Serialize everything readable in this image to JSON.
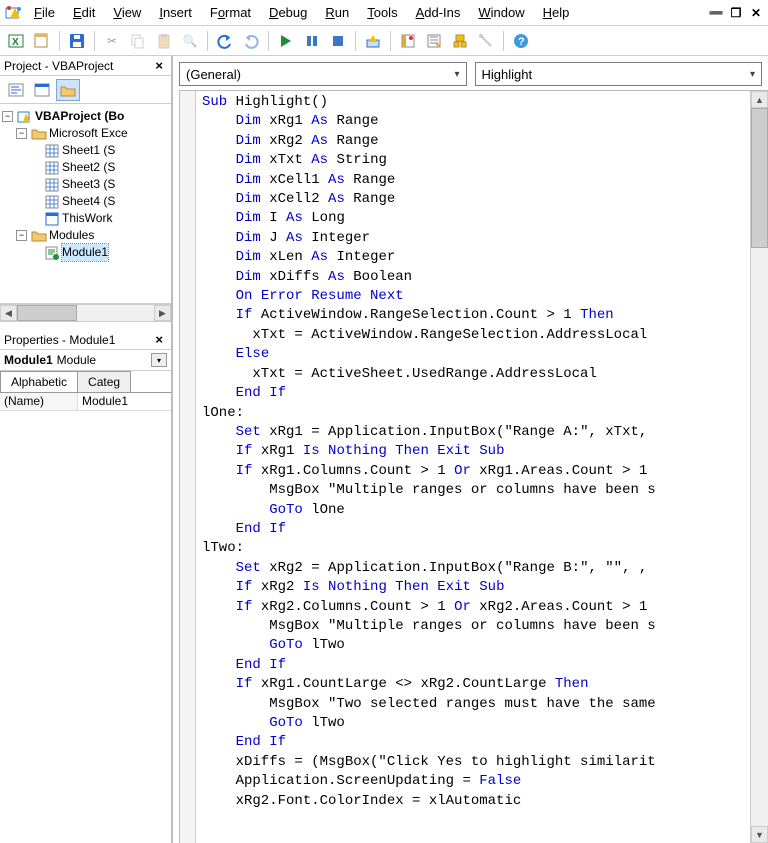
{
  "app": {
    "title": "Microsoft Visual Basic for Applications"
  },
  "menu": {
    "file": "File",
    "edit": "Edit",
    "view": "View",
    "insert": "Insert",
    "format": "Format",
    "debug": "Debug",
    "run": "Run",
    "tools": "Tools",
    "addins": "Add-Ins",
    "window": "Window",
    "help": "Help"
  },
  "project_panel": {
    "title": "Project - VBAProject",
    "root": "VBAProject (Bo",
    "excel_folder": "Microsoft Exce",
    "sheets": [
      "Sheet1 (S",
      "Sheet2 (S",
      "Sheet3 (S",
      "Sheet4 (S"
    ],
    "thisworkbook": "ThisWork",
    "modules_folder": "Modules",
    "module1": "Module1"
  },
  "properties_panel": {
    "title": "Properties - Module1",
    "selected_name": "Module1",
    "selected_type": "Module",
    "tabs": [
      "Alphabetic",
      "Categ"
    ],
    "prop_name_key": "(Name)",
    "prop_name_val": "Module1"
  },
  "dropdowns": {
    "object": "(General)",
    "proc": "Highlight"
  },
  "code_tokens": [
    [
      [
        "kw",
        "Sub"
      ],
      [
        "",
        " Highlight()"
      ]
    ],
    [
      [
        "",
        "    "
      ],
      [
        "kw",
        "Dim"
      ],
      [
        "",
        " xRg1 "
      ],
      [
        "kw",
        "As"
      ],
      [
        "",
        " Range"
      ]
    ],
    [
      [
        "",
        "    "
      ],
      [
        "kw",
        "Dim"
      ],
      [
        "",
        " xRg2 "
      ],
      [
        "kw",
        "As"
      ],
      [
        "",
        " Range"
      ]
    ],
    [
      [
        "",
        "    "
      ],
      [
        "kw",
        "Dim"
      ],
      [
        "",
        " xTxt "
      ],
      [
        "kw",
        "As"
      ],
      [
        "",
        " String"
      ]
    ],
    [
      [
        "",
        "    "
      ],
      [
        "kw",
        "Dim"
      ],
      [
        "",
        " xCell1 "
      ],
      [
        "kw",
        "As"
      ],
      [
        "",
        " Range"
      ]
    ],
    [
      [
        "",
        "    "
      ],
      [
        "kw",
        "Dim"
      ],
      [
        "",
        " xCell2 "
      ],
      [
        "kw",
        "As"
      ],
      [
        "",
        " Range"
      ]
    ],
    [
      [
        "",
        "    "
      ],
      [
        "kw",
        "Dim"
      ],
      [
        "",
        " I "
      ],
      [
        "kw",
        "As"
      ],
      [
        "",
        " Long"
      ]
    ],
    [
      [
        "",
        "    "
      ],
      [
        "kw",
        "Dim"
      ],
      [
        "",
        " J "
      ],
      [
        "kw",
        "As"
      ],
      [
        "",
        " Integer"
      ]
    ],
    [
      [
        "",
        "    "
      ],
      [
        "kw",
        "Dim"
      ],
      [
        "",
        " xLen "
      ],
      [
        "kw",
        "As"
      ],
      [
        "",
        " Integer"
      ]
    ],
    [
      [
        "",
        "    "
      ],
      [
        "kw",
        "Dim"
      ],
      [
        "",
        " xDiffs "
      ],
      [
        "kw",
        "As"
      ],
      [
        "",
        " Boolean"
      ]
    ],
    [
      [
        "",
        "    "
      ],
      [
        "kw",
        "On Error Resume Next"
      ]
    ],
    [
      [
        "",
        "    "
      ],
      [
        "kw",
        "If"
      ],
      [
        "",
        " ActiveWindow.RangeSelection.Count > 1 "
      ],
      [
        "kw",
        "Then"
      ]
    ],
    [
      [
        "",
        "      xTxt = ActiveWindow.RangeSelection.AddressLocal"
      ]
    ],
    [
      [
        "",
        "    "
      ],
      [
        "kw",
        "Else"
      ]
    ],
    [
      [
        "",
        "      xTxt = ActiveSheet.UsedRange.AddressLocal"
      ]
    ],
    [
      [
        "",
        "    "
      ],
      [
        "kw",
        "End If"
      ]
    ],
    [
      [
        "",
        "lOne:"
      ]
    ],
    [
      [
        "",
        "    "
      ],
      [
        "kw",
        "Set"
      ],
      [
        "",
        " xRg1 = Application.InputBox(\"Range A:\", xTxt,"
      ]
    ],
    [
      [
        "",
        "    "
      ],
      [
        "kw",
        "If"
      ],
      [
        "",
        " xRg1 "
      ],
      [
        "kw",
        "Is Nothing Then Exit Sub"
      ]
    ],
    [
      [
        "",
        "    "
      ],
      [
        "kw",
        "If"
      ],
      [
        "",
        " xRg1.Columns.Count > 1 "
      ],
      [
        "kw",
        "Or"
      ],
      [
        "",
        " xRg1.Areas.Count > 1 "
      ]
    ],
    [
      [
        "",
        "        MsgBox \"Multiple ranges or columns have been s"
      ]
    ],
    [
      [
        "",
        "        "
      ],
      [
        "kw",
        "GoTo"
      ],
      [
        "",
        " lOne"
      ]
    ],
    [
      [
        "",
        "    "
      ],
      [
        "kw",
        "End If"
      ]
    ],
    [
      [
        "",
        "lTwo:"
      ]
    ],
    [
      [
        "",
        "    "
      ],
      [
        "kw",
        "Set"
      ],
      [
        "",
        " xRg2 = Application.InputBox(\"Range B:\", \"\", ,"
      ]
    ],
    [
      [
        "",
        "    "
      ],
      [
        "kw",
        "If"
      ],
      [
        "",
        " xRg2 "
      ],
      [
        "kw",
        "Is Nothing Then Exit Sub"
      ]
    ],
    [
      [
        "",
        "    "
      ],
      [
        "kw",
        "If"
      ],
      [
        "",
        " xRg2.Columns.Count > 1 "
      ],
      [
        "kw",
        "Or"
      ],
      [
        "",
        " xRg2.Areas.Count > 1 "
      ]
    ],
    [
      [
        "",
        "        MsgBox \"Multiple ranges or columns have been s"
      ]
    ],
    [
      [
        "",
        "        "
      ],
      [
        "kw",
        "GoTo"
      ],
      [
        "",
        " lTwo"
      ]
    ],
    [
      [
        "",
        "    "
      ],
      [
        "kw",
        "End If"
      ]
    ],
    [
      [
        "",
        "    "
      ],
      [
        "kw",
        "If"
      ],
      [
        "",
        " xRg1.CountLarge <> xRg2.CountLarge "
      ],
      [
        "kw",
        "Then"
      ]
    ],
    [
      [
        "",
        "        MsgBox \"Two selected ranges must have the same"
      ]
    ],
    [
      [
        "",
        "        "
      ],
      [
        "kw",
        "GoTo"
      ],
      [
        "",
        " lTwo"
      ]
    ],
    [
      [
        "",
        "    "
      ],
      [
        "kw",
        "End If"
      ]
    ],
    [
      [
        "",
        "    xDiffs = (MsgBox(\"Click Yes to highlight similarit"
      ]
    ],
    [
      [
        "",
        "    Application.ScreenUpdating = "
      ],
      [
        "kw",
        "False"
      ]
    ],
    [
      [
        "",
        "    xRg2.Font.ColorIndex = xlAutomatic"
      ]
    ]
  ]
}
